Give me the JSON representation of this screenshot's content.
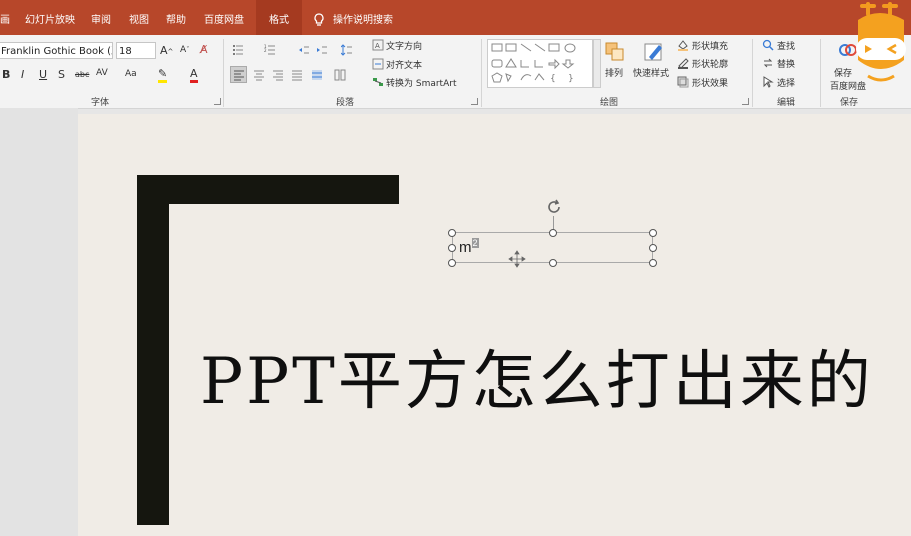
{
  "tabs": [
    {
      "label": "画",
      "active": false
    },
    {
      "label": "幻灯片放映",
      "active": false
    },
    {
      "label": "审阅",
      "active": false
    },
    {
      "label": "视图",
      "active": false
    },
    {
      "label": "帮助",
      "active": false
    },
    {
      "label": "百度网盘",
      "active": false
    },
    {
      "label": "格式",
      "active": true
    }
  ],
  "tell_me": "操作说明搜索",
  "font": {
    "name": "Franklin Gothic Book (正",
    "size": "18",
    "group_label": "字体"
  },
  "paragraph": {
    "group_label": "段落",
    "text_direction": "文字方向",
    "align_text": "对齐文本",
    "convert_smartart": "转换为 SmartArt"
  },
  "drawing": {
    "group_label": "绘图",
    "arrange": "排列",
    "quick_styles": "快速样式",
    "shape_fill": "形状填充",
    "shape_outline": "形状轮廓",
    "shape_effects": "形状效果"
  },
  "editing": {
    "group_label": "编辑",
    "find": "查找",
    "replace": "替换",
    "select": "选择"
  },
  "save": {
    "group_label": "保存",
    "save_label": "保存",
    "baidu_label": "百度网盘"
  },
  "slide": {
    "title": "PPT平方怎么打出来的",
    "textbox_base": "m",
    "textbox_sup": "2"
  },
  "colors": {
    "accent": "#b7472a",
    "ribbon_bg": "#f3f3f3",
    "slide_bg": "#f0ece6",
    "bar": "#15160f"
  }
}
